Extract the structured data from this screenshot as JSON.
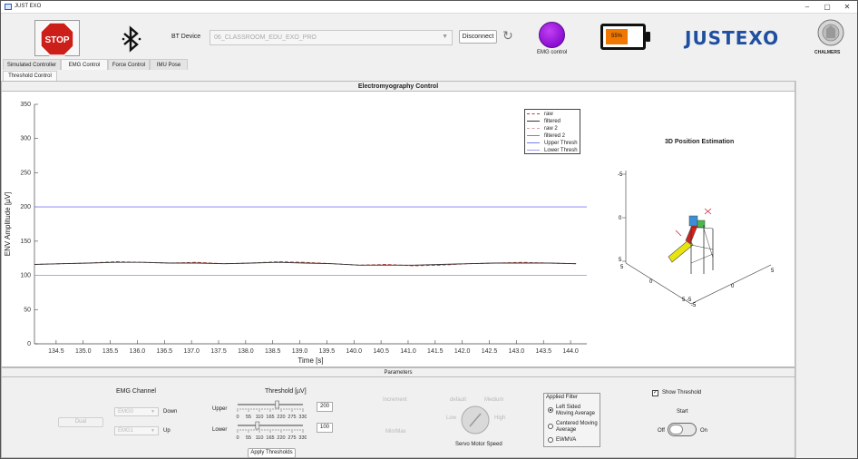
{
  "window": {
    "title": "JUST EXO",
    "min": "–",
    "max": "▢",
    "close": "✕"
  },
  "toolbar": {
    "stop_label": "STOP",
    "bt_label": "BT Device",
    "device_value": "06_CLASSROOM_EDU_EXO_PRO",
    "disconnect_label": "Disconnect",
    "emg_control_label": "EMG control",
    "battery_label": "55%",
    "battery_level": 0.55,
    "brand": "JUSTEXO",
    "seal_text": "CHALMERS",
    "icons": {
      "bluetooth": "bluetooth-icon",
      "refresh": "refresh-icon"
    }
  },
  "tabs": [
    {
      "label": "Simulated Controller"
    },
    {
      "label": "EMG Control"
    },
    {
      "label": "Force Control"
    },
    {
      "label": "IMU Pose"
    }
  ],
  "subtab": "Threshold Control",
  "panel_title": "Electromyography Control",
  "chart_data": [
    {
      "type": "line",
      "xlabel": "Time [s]",
      "ylabel": "ENV Amplitude [µV]",
      "xlim": [
        134.1,
        144.3
      ],
      "ylim": [
        0,
        350
      ],
      "xticks": [
        "134.5",
        "135.0",
        "135.5",
        "136.0",
        "136.5",
        "137.0",
        "137.5",
        "138.0",
        "138.5",
        "139.0",
        "139.5",
        "140.0",
        "140.5",
        "141.0",
        "141.5",
        "142.0",
        "142.5",
        "143.0",
        "143.5",
        "144.0"
      ],
      "yticks": [
        "0",
        "50",
        "100",
        "150",
        "200",
        "250",
        "300",
        "350"
      ],
      "legend_position": "top-right",
      "series": [
        {
          "name": "raw",
          "color": "#c0392b",
          "style": "dashed",
          "x": [
            134.1,
            134.6,
            135.1,
            135.6,
            136.1,
            136.6,
            137.1,
            137.6,
            138.1,
            138.6,
            139.1,
            139.6,
            140.1,
            140.6,
            141.1,
            141.6,
            142.1,
            142.6,
            143.1,
            143.6,
            144.1
          ],
          "y": [
            116,
            117,
            118,
            120,
            119,
            118,
            119,
            117,
            118,
            120,
            119,
            117,
            115,
            116,
            114,
            115,
            117,
            118,
            119,
            118,
            117
          ]
        },
        {
          "name": "filtered",
          "color": "#333333",
          "style": "solid",
          "x": [
            134.1,
            134.6,
            135.1,
            135.6,
            136.1,
            136.6,
            137.1,
            137.6,
            138.1,
            138.6,
            139.1,
            139.6,
            140.1,
            140.6,
            141.1,
            141.6,
            142.1,
            142.6,
            143.1,
            143.6,
            144.1
          ],
          "y": [
            116,
            117,
            118,
            119,
            119,
            118,
            118,
            117,
            118,
            119,
            118,
            117,
            115,
            115,
            115,
            116,
            117,
            118,
            118,
            118,
            117
          ]
        },
        {
          "name": "raw 2",
          "color": "#d9a0a0",
          "style": "dashed",
          "x": [],
          "y": []
        },
        {
          "name": "filtered 2",
          "color": "#888888",
          "style": "solid",
          "x": [],
          "y": []
        },
        {
          "name": "Upper Thresh",
          "color": "#7b7bf0",
          "style": "solid",
          "x": [
            134.1,
            144.3
          ],
          "y": [
            200,
            200
          ]
        },
        {
          "name": "Lower Thresh",
          "color": "#9c9cf5",
          "style": "solid",
          "x": [
            134.1,
            144.3
          ],
          "y": [
            100,
            100
          ]
        }
      ]
    },
    {
      "type": "scatter",
      "title": "3D Position Estimation",
      "zticks": [
        "-5",
        "0",
        "5"
      ],
      "xticks": [
        "0",
        "5"
      ],
      "yticks": [
        "0",
        "5"
      ],
      "extra_ticks": [
        "5",
        "-5",
        "-5"
      ]
    }
  ],
  "params": {
    "title": "Parameters",
    "emg_channel_label": "EMG Channel",
    "dual_label": "Dual",
    "emg0_value": "EMG0",
    "emg1_value": "EMG1",
    "down_label": "Down",
    "up_label": "Up",
    "threshold_label": "Threshold [µV]",
    "upper_label": "Upper",
    "lower_label": "Lower",
    "upper_value": "200",
    "lower_value": "100",
    "upper_level": 0.606,
    "lower_level": 0.303,
    "slider_ticks": [
      "0",
      "55",
      "110",
      "165",
      "220",
      "275",
      "330"
    ],
    "apply_label": "Apply Thresholds",
    "increment_label": "Increment",
    "minmax_label": "Min/Max",
    "default_label": "default",
    "medium_label": "Medium",
    "low_label": "Low",
    "high_label": "High",
    "servo_label": "Servo Motor Speed",
    "applied_filter_label": "Applied Filter",
    "filters": [
      "Left Sided Moving Average",
      "Centered Moving Average",
      "EWMVA"
    ],
    "show_threshold_label": "Show Threshold",
    "start_label": "Start",
    "off_label": "Off",
    "on_label": "On"
  }
}
